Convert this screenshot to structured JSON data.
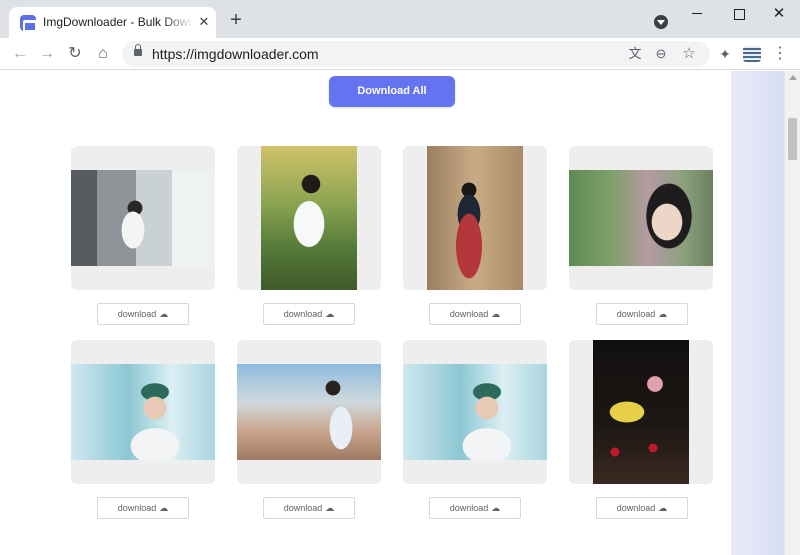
{
  "browser": {
    "tab_title": "ImgDownloader - Bulk Download Images",
    "tab_close": "✕",
    "new_tab": "+",
    "url": "https://imgdownloader.com",
    "icons": {
      "back": "←",
      "forward": "→",
      "reload": "↻",
      "home": "⌂",
      "translate": "⽂",
      "zoom": "⊖",
      "star": "☆",
      "extensions": "✦",
      "menu": "⋮",
      "close": "✕"
    }
  },
  "page": {
    "download_all_label": "Download All",
    "download_label": "download",
    "download_icon": "☁"
  }
}
